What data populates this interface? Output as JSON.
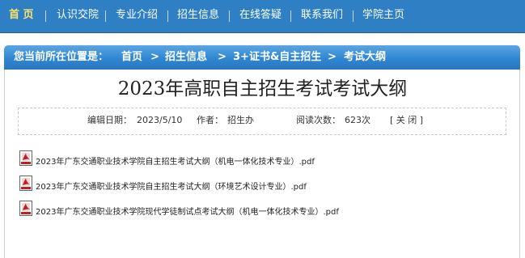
{
  "nav": {
    "items": [
      "首 页",
      "认识交院",
      "专业介绍",
      "招生信息",
      "在线答疑",
      "联系我们",
      "学院主页"
    ]
  },
  "breadcrumb": {
    "prefix": "您当前所在位置是：",
    "items": [
      "首页",
      "招生信息",
      "3+证书&自主招生",
      "考试大纲"
    ],
    "separator": ">"
  },
  "article": {
    "title": "2023年高职自主招生考试考试大纲",
    "date_label": "编辑日期：",
    "date": "2023/5/10",
    "author_label": "作者：",
    "author": "招生办",
    "views_label": "阅读次数：",
    "views": "623次",
    "close_label": "[ 关 闭 ]"
  },
  "attachments": [
    {
      "name": "2023年广东交通职业技术学院自主招生考试大纲（机电一体化技术专业）.pdf",
      "icon": "pdf-icon"
    },
    {
      "name": "2023年广东交通职业技术学院自主招生考试大纲（环境艺术设计专业）.pdf",
      "icon": "pdf-icon"
    },
    {
      "name": "2023年广东交通职业技术学院现代学徒制试点考试大纲（机电一体化技术专业）.pdf",
      "icon": "pdf-icon"
    }
  ],
  "colors": {
    "nav_bg": "#2f7fc4",
    "active": "#f7e36b",
    "crumb_bg": "#2f86d0"
  }
}
